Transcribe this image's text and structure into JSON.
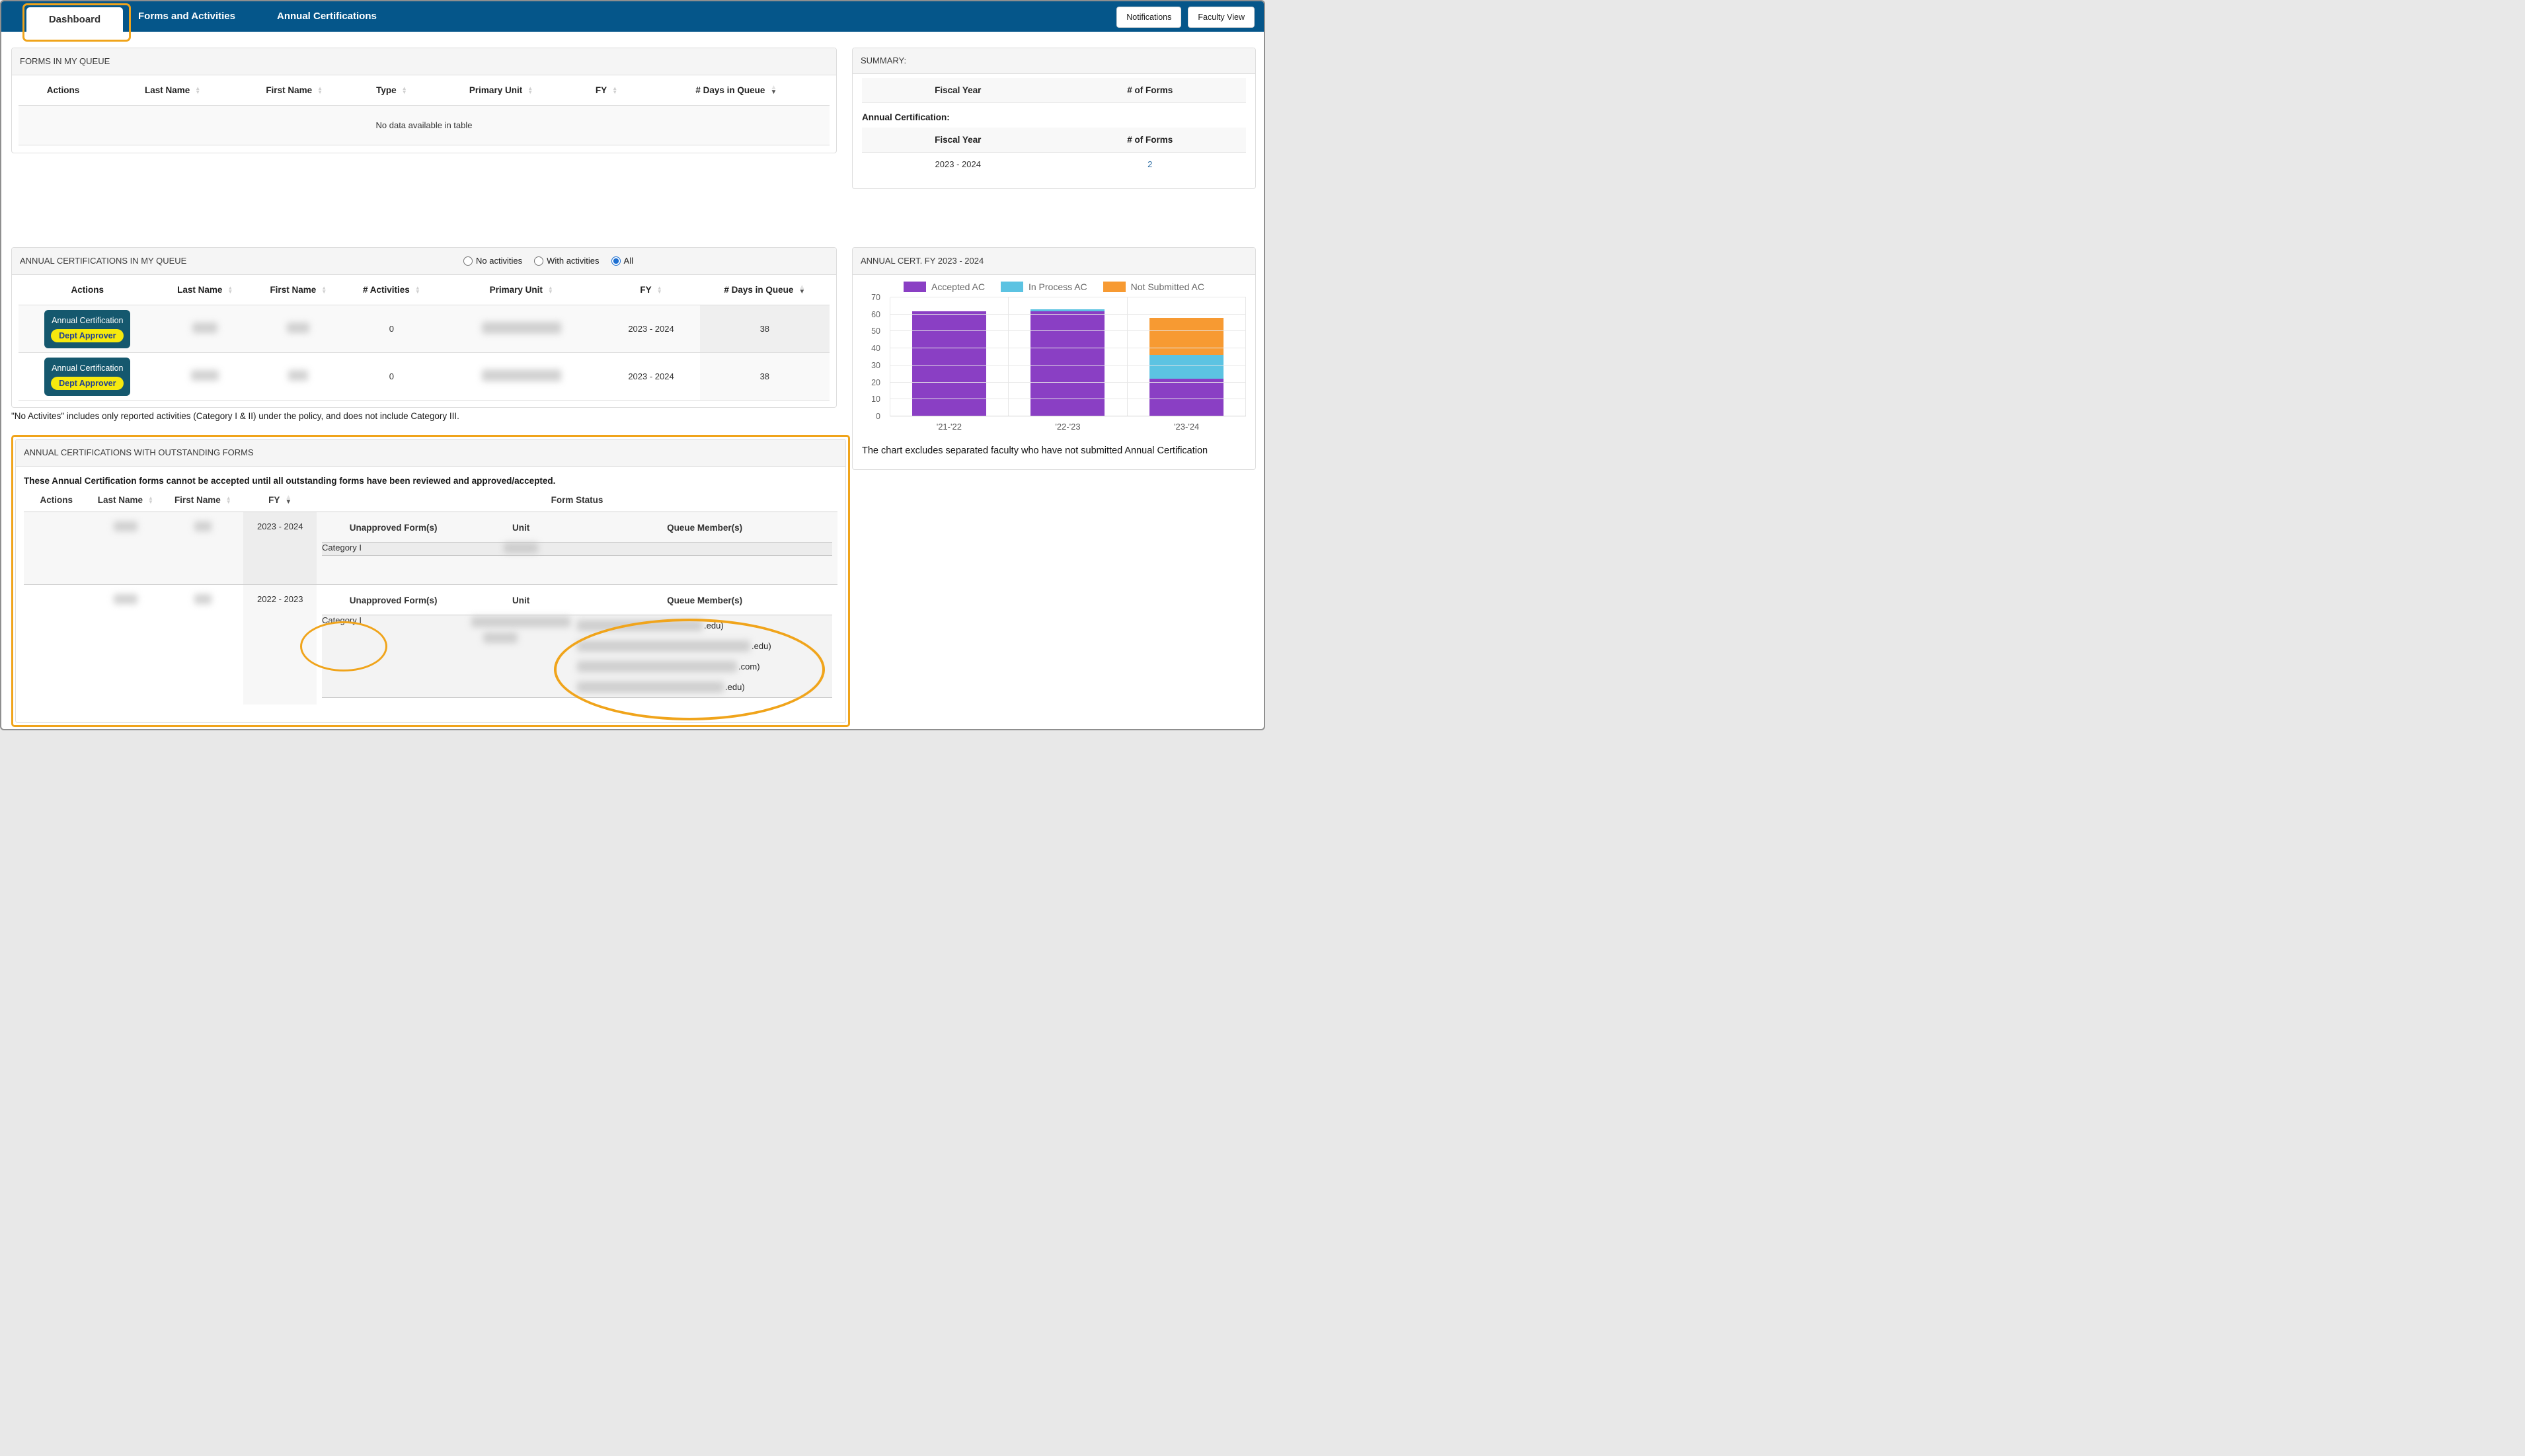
{
  "theme": {
    "nav_blue": "#05568A",
    "annotation_orange": "#F0A41B",
    "action_button_teal": "#15586E",
    "badge_yellow": "#F6E90E",
    "badge_text_blue": "#203F92",
    "link_blue": "#2E6DA4"
  },
  "nav": {
    "tabs": [
      {
        "label": "Dashboard",
        "active": true
      },
      {
        "label": "Forms and Activities",
        "active": false
      },
      {
        "label": "Annual Certifications",
        "active": false
      }
    ],
    "buttons": [
      {
        "label": "Notifications"
      },
      {
        "label": "Faculty View"
      }
    ]
  },
  "forms_queue": {
    "title": "FORMS IN MY QUEUE",
    "columns": [
      "Actions",
      "Last Name",
      "First Name",
      "Type",
      "Primary Unit",
      "FY",
      "# Days in Queue"
    ],
    "empty_text": "No data available in table"
  },
  "summary": {
    "title": "SUMMARY:",
    "table1": {
      "columns": [
        "Fiscal Year",
        "# of Forms"
      ]
    },
    "annual_certification_label": "Annual Certification:",
    "table2": {
      "columns": [
        "Fiscal Year",
        "# of Forms"
      ],
      "rows": [
        {
          "fiscal_year": "2023 - 2024",
          "num_forms": "2"
        }
      ]
    }
  },
  "ac_queue": {
    "title": "ANNUAL CERTIFICATIONS IN MY QUEUE",
    "filters": [
      {
        "label": "No activities",
        "checked": false
      },
      {
        "label": "With activities",
        "checked": false
      },
      {
        "label": "All",
        "checked": true
      }
    ],
    "columns": [
      "Actions",
      "Last Name",
      "First Name",
      "# Activities",
      "Primary Unit",
      "FY",
      "# Days in Queue"
    ],
    "rows": [
      {
        "action_label": "Annual Certification",
        "action_badge": "Dept Approver",
        "activities": "0",
        "fy": "2023 - 2024",
        "days": "38"
      },
      {
        "action_label": "Annual Certification",
        "action_badge": "Dept Approver",
        "activities": "0",
        "fy": "2023 - 2024",
        "days": "38"
      }
    ],
    "footnote": "\"No Activites\" includes only reported activities (Category I & II) under the policy, and does not include Category III."
  },
  "chart_panel": {
    "title": "ANNUAL CERT. FY 2023 - 2024",
    "caption": "The chart excludes separated faculty who have not submitted Annual Certification"
  },
  "chart_data": {
    "type": "bar",
    "stacked": true,
    "categories": [
      "'21-'22",
      "'22-'23",
      "'23-'24"
    ],
    "series": [
      {
        "name": "Accepted AC",
        "color": "#8A3FC4",
        "values": [
          62,
          62,
          22
        ]
      },
      {
        "name": "In Process AC",
        "color": "#5CC3E2",
        "values": [
          0,
          1,
          14
        ]
      },
      {
        "name": "Not Submitted AC",
        "color": "#F79A32",
        "values": [
          0,
          0,
          22
        ]
      }
    ],
    "ylim": [
      0,
      70
    ],
    "ytick_step": 10,
    "legend_position": "top",
    "grid": true
  },
  "outstanding": {
    "title": "ANNUAL CERTIFICATIONS WITH OUTSTANDING FORMS",
    "description": "These Annual Certification forms cannot be accepted until all outstanding forms have been reviewed and approved/accepted.",
    "columns": [
      "Actions",
      "Last Name",
      "First Name",
      "FY",
      "Form Status"
    ],
    "nested_columns": [
      "Unapproved Form(s)",
      "Unit",
      "Queue Member(s)"
    ],
    "rows": [
      {
        "fy": "2023 - 2024",
        "form_name": "Category I",
        "queue_suffixes": []
      },
      {
        "fy": "2022 - 2023",
        "form_name": "Category I",
        "queue_suffixes": [
          ".edu)",
          ".edu)",
          ".com)",
          ".edu)"
        ]
      }
    ]
  }
}
